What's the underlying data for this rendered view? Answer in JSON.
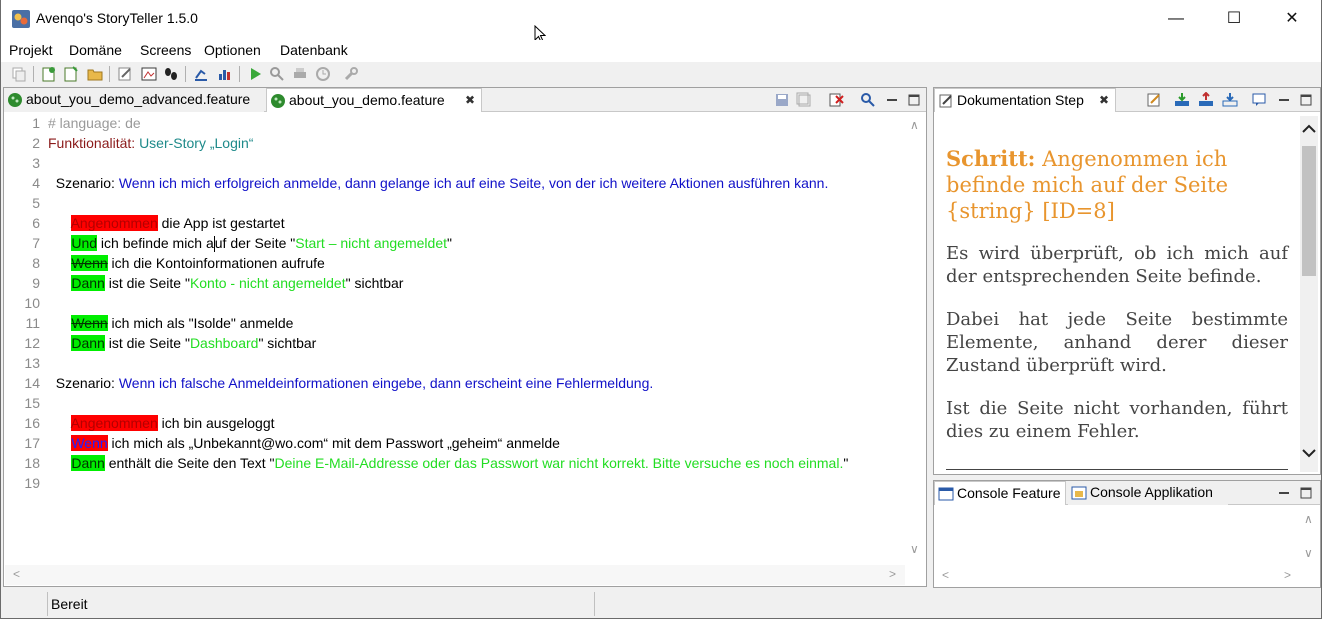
{
  "window": {
    "title": "Avenqo's StoryTeller 1.5.0"
  },
  "menu": [
    "Projekt",
    "Domäne",
    "Screens",
    "Optionen",
    "Datenbank"
  ],
  "editor": {
    "tabs": [
      {
        "label": "about_you_demo_advanced.feature",
        "active": false
      },
      {
        "label": "about_you_demo.feature",
        "active": true
      }
    ],
    "lines": [
      {
        "n": "1",
        "parts": [
          {
            "t": "# language: de",
            "c": "c-comment"
          }
        ]
      },
      {
        "n": "2",
        "parts": [
          {
            "t": "Funktionalität: ",
            "c": "c-key"
          },
          {
            "t": "User-Story „Login“",
            "c": "c-teal"
          }
        ]
      },
      {
        "n": "3",
        "parts": []
      },
      {
        "n": "4",
        "parts": [
          {
            "t": "  Szenario: ",
            "c": ""
          },
          {
            "t": "Wenn ich mich erfolgreich anmelde, dann gelange ich auf eine Seite, von der ich weitere Aktionen ausführen kann.",
            "c": "c-blue"
          }
        ]
      },
      {
        "n": "5",
        "parts": []
      },
      {
        "n": "6",
        "parts": [
          {
            "t": "      ",
            "c": ""
          },
          {
            "t": "Angenommen",
            "c": "kw-red"
          },
          {
            "t": " die App ist gestartet",
            "c": ""
          }
        ]
      },
      {
        "n": "7",
        "parts": [
          {
            "t": "      ",
            "c": ""
          },
          {
            "t": "Und",
            "c": "kw-green"
          },
          {
            "t": " ich befinde mich a",
            "c": ""
          },
          {
            "t": "",
            "c": "caret"
          },
          {
            "t": "uf der Seite \"",
            "c": ""
          },
          {
            "t": "Start – nicht angemeldet",
            "c": "c-green"
          },
          {
            "t": "\"",
            "c": ""
          }
        ]
      },
      {
        "n": "8",
        "parts": [
          {
            "t": "      ",
            "c": ""
          },
          {
            "t": "Wenn",
            "c": "kw-green-strike"
          },
          {
            "t": " ich die Kontoinformationen aufrufe",
            "c": ""
          }
        ]
      },
      {
        "n": "9",
        "parts": [
          {
            "t": "      ",
            "c": ""
          },
          {
            "t": "Dann",
            "c": "kw-green"
          },
          {
            "t": " ist die Seite \"",
            "c": ""
          },
          {
            "t": "Konto - nicht angemeldet",
            "c": "c-green"
          },
          {
            "t": "\" sichtbar",
            "c": ""
          }
        ]
      },
      {
        "n": "10",
        "parts": []
      },
      {
        "n": "11",
        "parts": [
          {
            "t": "      ",
            "c": ""
          },
          {
            "t": "Wenn",
            "c": "kw-green-strike"
          },
          {
            "t": " ich mich als \"Isolde\" anmelde",
            "c": ""
          }
        ]
      },
      {
        "n": "12",
        "parts": [
          {
            "t": "      ",
            "c": ""
          },
          {
            "t": "Dann",
            "c": "kw-green"
          },
          {
            "t": " ist die Seite \"",
            "c": ""
          },
          {
            "t": "Dashboard",
            "c": "c-green"
          },
          {
            "t": "\" sichtbar",
            "c": ""
          }
        ]
      },
      {
        "n": "13",
        "parts": []
      },
      {
        "n": "14",
        "parts": [
          {
            "t": "  Szenario: ",
            "c": ""
          },
          {
            "t": "Wenn ich falsche Anmeldeinformationen eingebe, dann erscheint eine Fehlermeldung.",
            "c": "c-blue"
          }
        ]
      },
      {
        "n": "15",
        "parts": []
      },
      {
        "n": "16",
        "parts": [
          {
            "t": "      ",
            "c": ""
          },
          {
            "t": "Angenommen",
            "c": "kw-red"
          },
          {
            "t": " ich bin ausgeloggt",
            "c": ""
          }
        ]
      },
      {
        "n": "17",
        "parts": [
          {
            "t": "      ",
            "c": ""
          },
          {
            "t": "Wenn",
            "c": "kw-red-blue"
          },
          {
            "t": " ich mich als „Unbekannt@wo.com“ mit dem Passwort „geheim“ anmelde",
            "c": ""
          }
        ]
      },
      {
        "n": "18",
        "parts": [
          {
            "t": "      ",
            "c": ""
          },
          {
            "t": "Dann",
            "c": "kw-green"
          },
          {
            "t": " enthält die Seite den Text \"",
            "c": ""
          },
          {
            "t": "Deine E-Mail-Addresse oder das Passwort war nicht korrekt. Bitte versuche es noch einmal.",
            "c": "c-green"
          },
          {
            "t": "\"",
            "c": ""
          }
        ]
      },
      {
        "n": "19",
        "parts": []
      }
    ]
  },
  "doc": {
    "tab_label": "Dokumentation Step",
    "heading_label": "Schritt:",
    "heading_text": " Angenommen ich befinde mich auf der Seite {string} [ID=8]",
    "paragraphs": [
      "Es wird überprüft, ob ich mich auf der entsprechenden Seite befinde.",
      "Dabei hat jede Seite bestimmte Elemente, anhand derer dieser Zustand überprüft wird.",
      "Ist die Seite nicht vorhanden, führt dies zu einem Fehler."
    ]
  },
  "console": {
    "tabs": [
      "Console Feature",
      "Console Applikation"
    ]
  },
  "status": {
    "text": "Bereit"
  }
}
